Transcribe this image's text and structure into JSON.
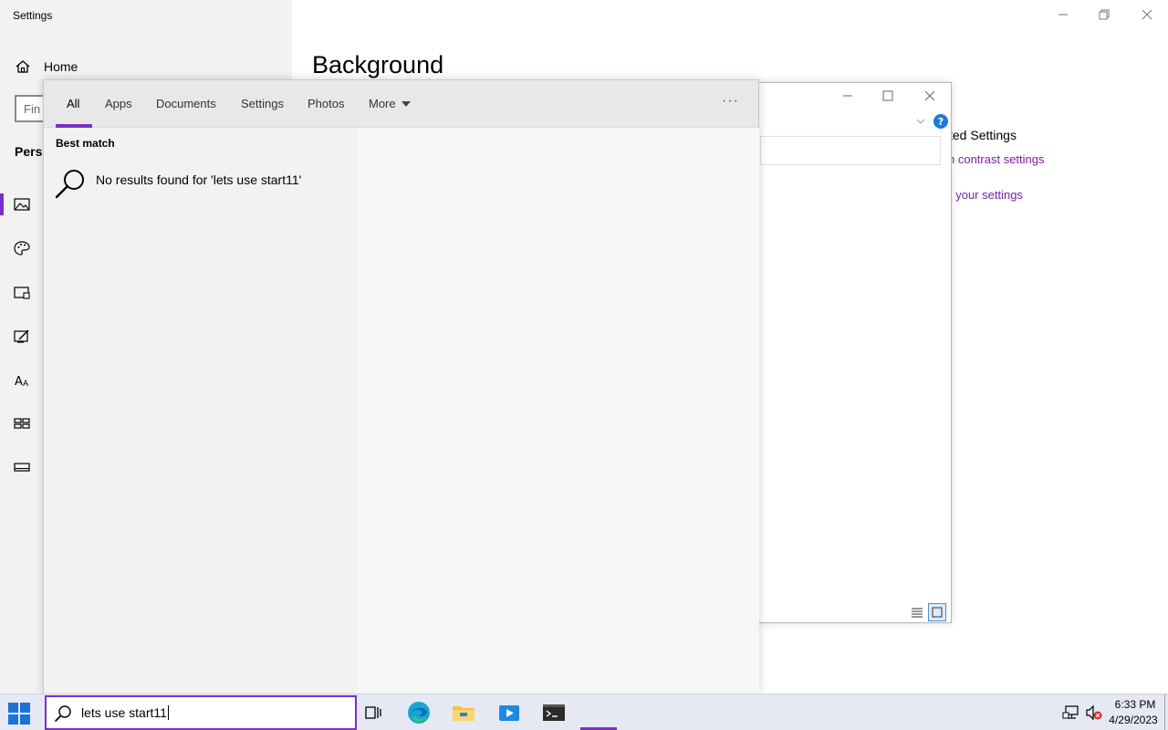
{
  "settings": {
    "window_title": "Settings",
    "home_label": "Home",
    "find_placeholder": "Fin",
    "section_label": "Perso",
    "page_heading": "Background",
    "related_title": "ted Settings",
    "related_link1": "n contrast settings",
    "related_link2": "; your settings"
  },
  "search": {
    "tabs": [
      {
        "label": "All"
      },
      {
        "label": "Apps"
      },
      {
        "label": "Documents"
      },
      {
        "label": "Settings"
      },
      {
        "label": "Photos"
      },
      {
        "label": "More"
      }
    ],
    "more_options": "···",
    "best_match_label": "Best match",
    "no_results_text": "No results found for 'lets use start11'",
    "query": "lets use start11"
  },
  "taskbar": {
    "time": "6:33 PM",
    "date": "4/29/2023"
  },
  "colors": {
    "accent": "#7a2ec9",
    "link": "#7a1fa2",
    "taskbar_bg": "#e6e9f3"
  }
}
